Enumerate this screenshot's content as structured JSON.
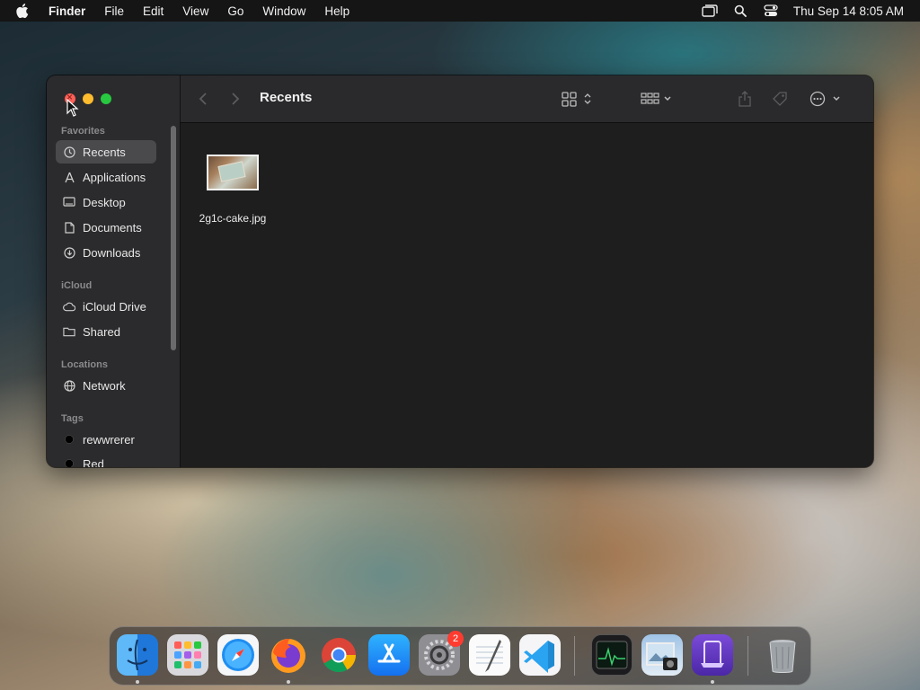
{
  "menubar": {
    "app": "Finder",
    "items": [
      "File",
      "Edit",
      "View",
      "Go",
      "Window",
      "Help"
    ],
    "clock": "Thu Sep 14  8:05 AM",
    "icons": [
      "screen-mirroring-icon",
      "spotlight-search-icon",
      "control-center-icon"
    ]
  },
  "window": {
    "title": "Recents",
    "sidebar": {
      "favorites_label": "Favorites",
      "favorites": [
        "Recents",
        "Applications",
        "Desktop",
        "Documents",
        "Downloads"
      ],
      "icloud_label": "iCloud",
      "icloud": [
        "iCloud Drive",
        "Shared"
      ],
      "locations_label": "Locations",
      "locations": [
        "Network"
      ],
      "tags_label": "Tags",
      "tags": [
        "rewwrerer",
        "Red"
      ]
    },
    "files": [
      {
        "name": "2g1c-cake.jpg"
      }
    ]
  },
  "dock": {
    "apps": [
      "Finder",
      "Launchpad",
      "Safari",
      "Firefox",
      "Google Chrome",
      "App Store",
      "System Settings",
      "TextEdit",
      "Visual Studio Code",
      "Activity Monitor",
      "Preview",
      "Simulator",
      "Trash"
    ],
    "system_settings_badge": "2"
  }
}
